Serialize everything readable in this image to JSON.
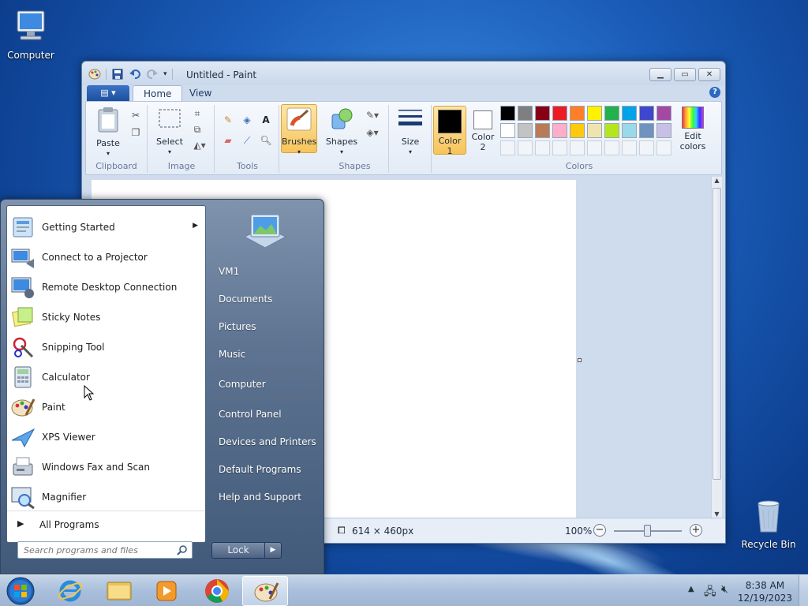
{
  "desktop": {
    "computer_label": "Computer",
    "recycle_label": "Recycle Bin"
  },
  "paint": {
    "title": "Untitled - Paint",
    "tabs": [
      {
        "label": "Home"
      },
      {
        "label": "View"
      }
    ],
    "groups": {
      "clipboard": "Clipboard",
      "image": "Image",
      "tools": "Tools",
      "shapes": "Shapes",
      "colors": "Colors"
    },
    "buttons": {
      "paste": "Paste",
      "select": "Select",
      "brushes": "Brushes",
      "shapes": "Shapes",
      "size": "Size",
      "color1_line1": "Color",
      "color1_line2": "1",
      "color2_line1": "Color",
      "color2_line2": "2",
      "edit_colors_line1": "Edit",
      "edit_colors_line2": "colors"
    },
    "palette_row1": [
      "#000000",
      "#7f7f7f",
      "#880015",
      "#ed1c24",
      "#ff7f27",
      "#fff200",
      "#22b14c",
      "#00a2e8",
      "#3f48cc",
      "#a349a4"
    ],
    "palette_row2": [
      "#ffffff",
      "#c3c3c3",
      "#b97a57",
      "#ffaec9",
      "#ffc90e",
      "#efe4b0",
      "#b5e61d",
      "#99d9ea",
      "#7092be",
      "#c8bfe7"
    ],
    "color1": "#000000",
    "color2": "#ffffff",
    "status": {
      "dimensions": "614 × 460px",
      "zoom": "100%"
    }
  },
  "startmenu": {
    "programs": [
      {
        "label": "Getting Started",
        "has_submenu": true
      },
      {
        "label": "Connect to a Projector"
      },
      {
        "label": "Remote Desktop Connection"
      },
      {
        "label": "Sticky Notes"
      },
      {
        "label": "Snipping Tool"
      },
      {
        "label": "Calculator"
      },
      {
        "label": "Paint"
      },
      {
        "label": "XPS Viewer"
      },
      {
        "label": "Windows Fax and Scan"
      },
      {
        "label": "Magnifier"
      }
    ],
    "all_programs": "All Programs",
    "search_placeholder": "Search programs and files",
    "right_links": [
      {
        "label": "VM1"
      },
      {
        "label": "Documents"
      },
      {
        "label": "Pictures"
      },
      {
        "label": "Music"
      },
      {
        "label": "Computer"
      },
      {
        "label": "Control Panel"
      },
      {
        "label": "Devices and Printers"
      },
      {
        "label": "Default Programs"
      },
      {
        "label": "Help and Support"
      }
    ],
    "lock_label": "Lock"
  },
  "taskbar": {
    "time": "8:38 AM",
    "date": "12/19/2023",
    "pinned": [
      "internet-explorer",
      "windows-explorer",
      "media-player",
      "chrome",
      "paint"
    ]
  }
}
